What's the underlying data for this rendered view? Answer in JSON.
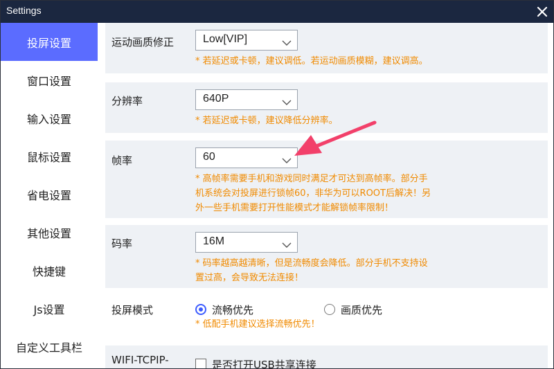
{
  "window": {
    "title": "Settings"
  },
  "sidebar": {
    "items": [
      {
        "label": "投屏设置",
        "active": true
      },
      {
        "label": "窗口设置"
      },
      {
        "label": "输入设置"
      },
      {
        "label": "鼠标设置"
      },
      {
        "label": "省电设置"
      },
      {
        "label": "其他设置"
      },
      {
        "label": "快捷键"
      },
      {
        "label": "Js设置"
      },
      {
        "label": "自定义工具栏"
      }
    ]
  },
  "settings": {
    "motion_quality": {
      "label": "运动画质修正",
      "value": "Low[VIP]",
      "hint": "* 若延迟或卡顿，建议调低。若运动画质模糊，建议调高。"
    },
    "resolution": {
      "label": "分辨率",
      "value": "640P",
      "hint": "* 若延迟或卡顿，建议降低分辨率。"
    },
    "frame_rate": {
      "label": "帧率",
      "value": "60",
      "hint_line1": "* 高帧率需要手机和游戏同时满足才可达到高帧率。部分手",
      "hint_line2": "机系统会对投屏进行锁帧60，非华为可以ROOT后解决！另",
      "hint_line3": "外一些手机需要打开性能模式才能解锁帧率限制！"
    },
    "bitrate": {
      "label": "码率",
      "value": "16M",
      "hint_line1": "* 码率越高越清晰，但是流畅度会降低。部分手机不支持设",
      "hint_line2": "置过高，会导致无法连接！"
    },
    "cast_mode": {
      "label": "投屏模式",
      "option1": "流畅优先",
      "option2": "画质优先",
      "selected": "流畅优先",
      "hint": "* 低配手机建议选择流畅优先！"
    },
    "wifi": {
      "label_line1": "WIFI-TCPIP-",
      "checkbox_label": "是否打开USB共享连接"
    }
  },
  "colors": {
    "accent": "#5b6cff",
    "hint": "#f08a00",
    "titlebar": "#1b2740",
    "card": "#eef1f5",
    "arrow": "#f2406a"
  }
}
